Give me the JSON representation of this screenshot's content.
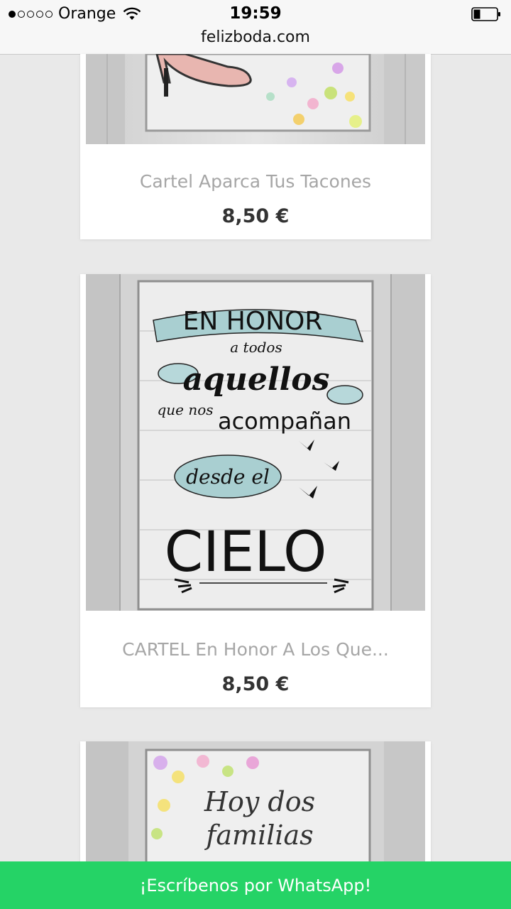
{
  "status_bar": {
    "carrier": "Orange",
    "time": "19:59"
  },
  "browser": {
    "url": "felizboda.com"
  },
  "products": [
    {
      "title": "Cartel Aparca Tus Tacones",
      "price": "8,50 €"
    },
    {
      "title": "CARTEL En Honor A Los Que...",
      "price": "8,50 €",
      "image_text": {
        "line1": "EN HONOR",
        "line2": "a todos",
        "line3": "aquellos",
        "line4a": "que nos",
        "line4b": "acompañan",
        "line5": "desde el",
        "line6": "CIELO"
      }
    },
    {
      "image_text": {
        "line1": "Hoy dos",
        "line2": "familias"
      }
    }
  ],
  "whatsapp_bar": {
    "label": "¡Escríbenos por WhatsApp!"
  },
  "colors": {
    "whatsapp": "#25d366",
    "background": "#e9e9e9",
    "price": "#333333",
    "title": "#a6a6a6"
  }
}
